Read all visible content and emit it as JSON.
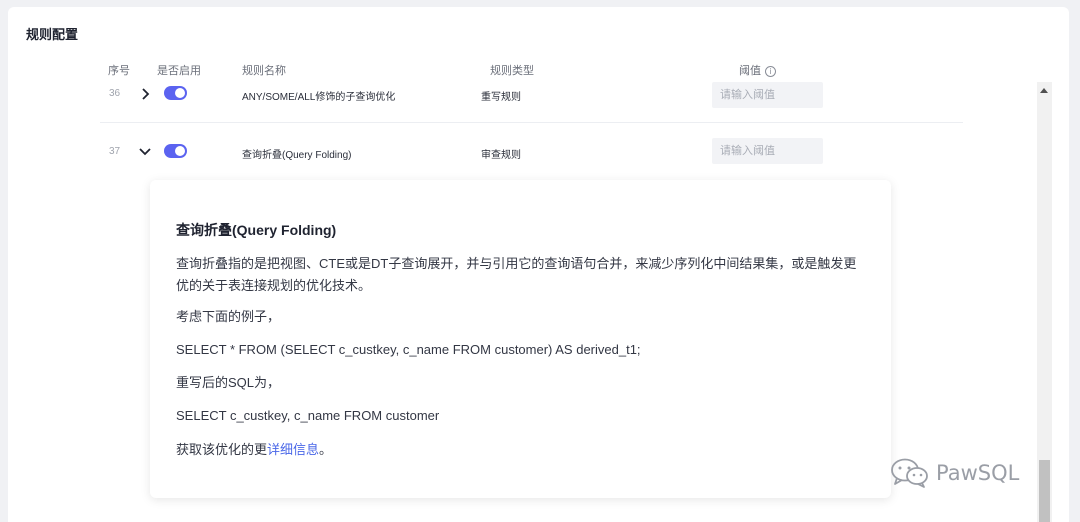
{
  "section": {
    "title": "规则配置"
  },
  "columns": {
    "index": "序号",
    "enabled": "是否启用",
    "name": "规则名称",
    "type": "规则类型",
    "threshold": "阈值"
  },
  "rows": [
    {
      "index": "36",
      "name": "ANY/SOME/ALL修饰的子查询优化",
      "type": "重写规则",
      "enabled": true,
      "expanded": false,
      "threshold_placeholder": "请输入阈值"
    },
    {
      "index": "37",
      "name": "查询折叠(Query Folding)",
      "type": "审查规则",
      "enabled": true,
      "expanded": true,
      "threshold_placeholder": "请输入阈值"
    }
  ],
  "detail": {
    "title": "查询折叠(Query Folding)",
    "description": "查询折叠指的是把视图、CTE或是DT子查询展开，并与引用它的查询语句合并，来减少序列化中间结果集，或是触发更优的关于表连接规划的优化技术。",
    "example_intro": "考虑下面的例子，",
    "example_sql": "SELECT * FROM (SELECT c_custkey, c_name FROM customer) AS derived_t1;",
    "rewrite_intro": "重写后的SQL为，",
    "rewrite_sql": "SELECT c_custkey, c_name FROM customer",
    "more_prefix": "获取该优化的更",
    "more_link": "详细信息",
    "more_suffix": "。"
  },
  "watermark": {
    "text": "PawSQL"
  },
  "colors": {
    "accent": "#5b63f0",
    "link": "#4a67e8"
  }
}
